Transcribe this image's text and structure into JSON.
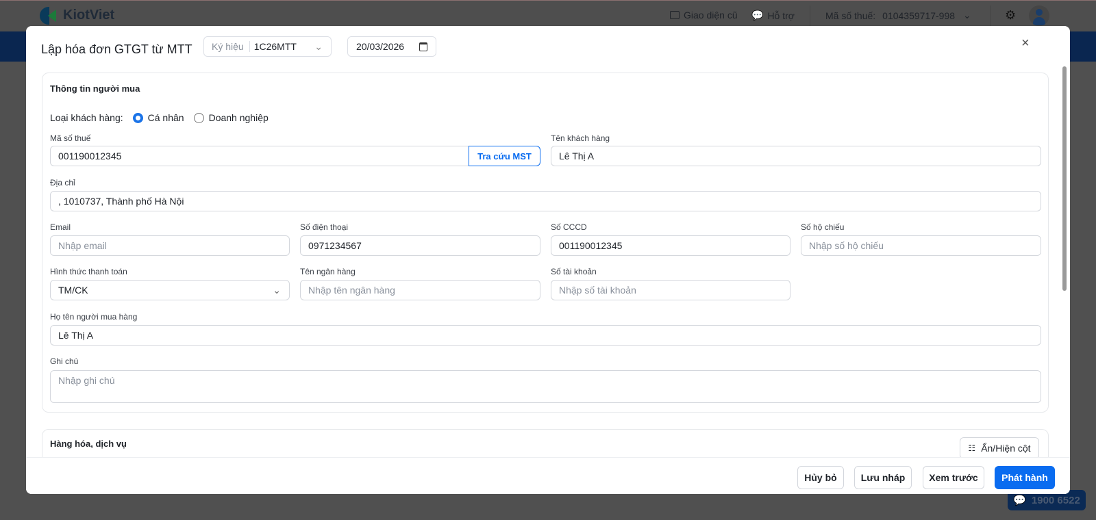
{
  "app": {
    "logo_text": "KiotViet",
    "old_ui": "Giao diện cũ",
    "support": "Hỗ trợ",
    "tax_label": "Mã số thuế:",
    "tax_value": "0104359717-998",
    "hotline": "1900 6522"
  },
  "modal": {
    "title": "Lập hóa đơn GTGT từ MTT",
    "symbol_label": "Ký hiệu",
    "symbol_value": "1C26MTT",
    "date": "20/03/2026",
    "buyer": {
      "title": "Thông tin người mua",
      "customer_type_label": "Loại khách hàng:",
      "types": [
        {
          "label": "Cá nhân",
          "selected": true
        },
        {
          "label": "Doanh nghiệp",
          "selected": false
        }
      ],
      "tax_code": {
        "label": "Mã số thuế",
        "value": "001190012345",
        "lookup": "Tra cứu MST"
      },
      "customer_name": {
        "label": "Tên khách hàng",
        "value": "Lê Thị A"
      },
      "address": {
        "label": "Địa chỉ",
        "value": ", 1010737, Thành phố Hà Nội"
      },
      "email": {
        "label": "Email",
        "placeholder": "Nhập email"
      },
      "phone": {
        "label": "Số điện thoại",
        "value": "0971234567"
      },
      "cccd": {
        "label": "Số CCCD",
        "value": "001190012345"
      },
      "passport": {
        "label": "Số hộ chiếu",
        "placeholder": "Nhập số hộ chiếu"
      },
      "payment": {
        "label": "Hình thức thanh toán",
        "value": "TM/CK"
      },
      "bank": {
        "label": "Tên ngân hàng",
        "placeholder": "Nhập tên ngân hàng"
      },
      "account": {
        "label": "Số tài khoản",
        "placeholder": "Nhập số tài khoản"
      },
      "buyer_name": {
        "label": "Họ tên người mua hàng",
        "value": "Lê Thị A"
      },
      "note": {
        "label": "Ghi chú",
        "placeholder": "Nhập ghi chú"
      }
    },
    "goods": {
      "title": "Hàng hóa, dịch vụ",
      "toggle_columns": "Ẩn/Hiện cột"
    },
    "footer": {
      "cancel": "Hủy bỏ",
      "draft": "Lưu nháp",
      "preview": "Xem trước",
      "issue": "Phát hành"
    }
  },
  "colors": {
    "primary": "#0a6cf0",
    "overlay": "#505050"
  }
}
